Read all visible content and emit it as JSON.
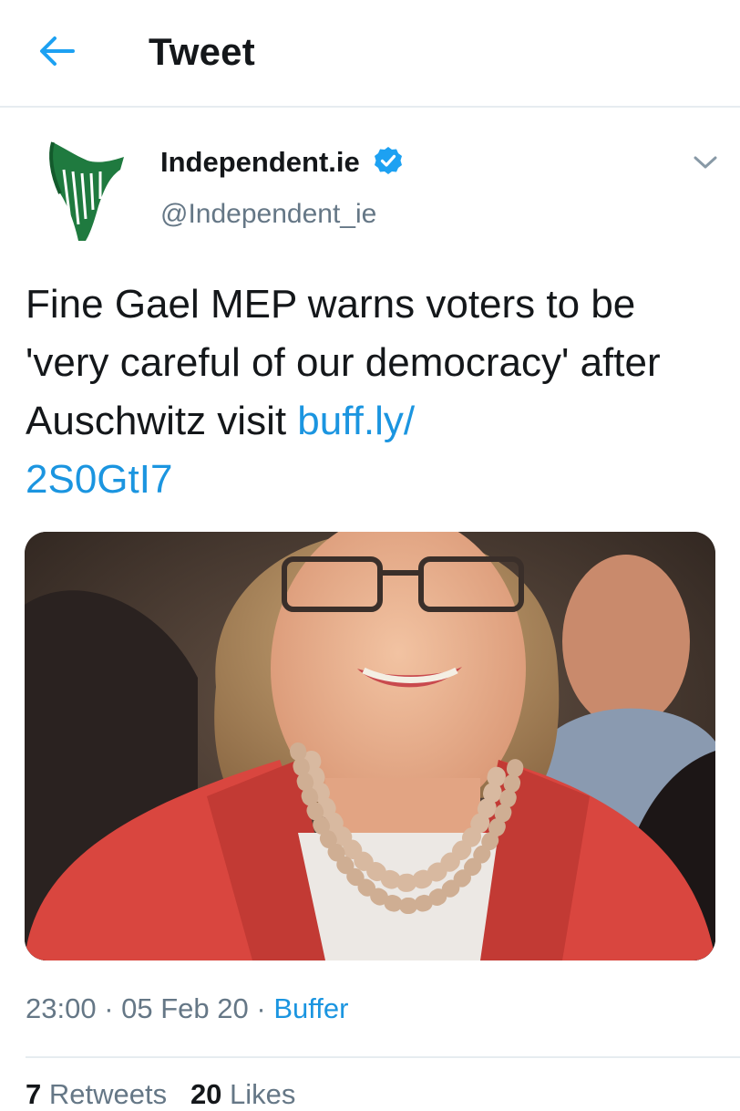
{
  "header": {
    "title": "Tweet",
    "back_icon": "arrow-left-icon",
    "accent_color": "#1da1f2"
  },
  "tweet": {
    "author_name": "Independent.ie",
    "verified_icon": "verified-badge-icon",
    "handle": "@Independent_ie",
    "avatar_icon": "harp-logo-icon",
    "menu_icon": "chevron-down-icon",
    "text": "Fine Gael MEP warns voters to be 'very careful of our democracy' after Auschwitz visit ",
    "link_text": "buff.ly/\n2S0GtI7",
    "link_color": "#1b95e0",
    "media_alt": "photo",
    "time": "23:00",
    "sep1": " · ",
    "date": "05 Feb 20",
    "sep2": " · ",
    "source": "Buffer"
  },
  "stats": {
    "retweets_count": "7",
    "retweets_label": " Retweets",
    "likes_count": "20",
    "likes_label": " Likes"
  }
}
